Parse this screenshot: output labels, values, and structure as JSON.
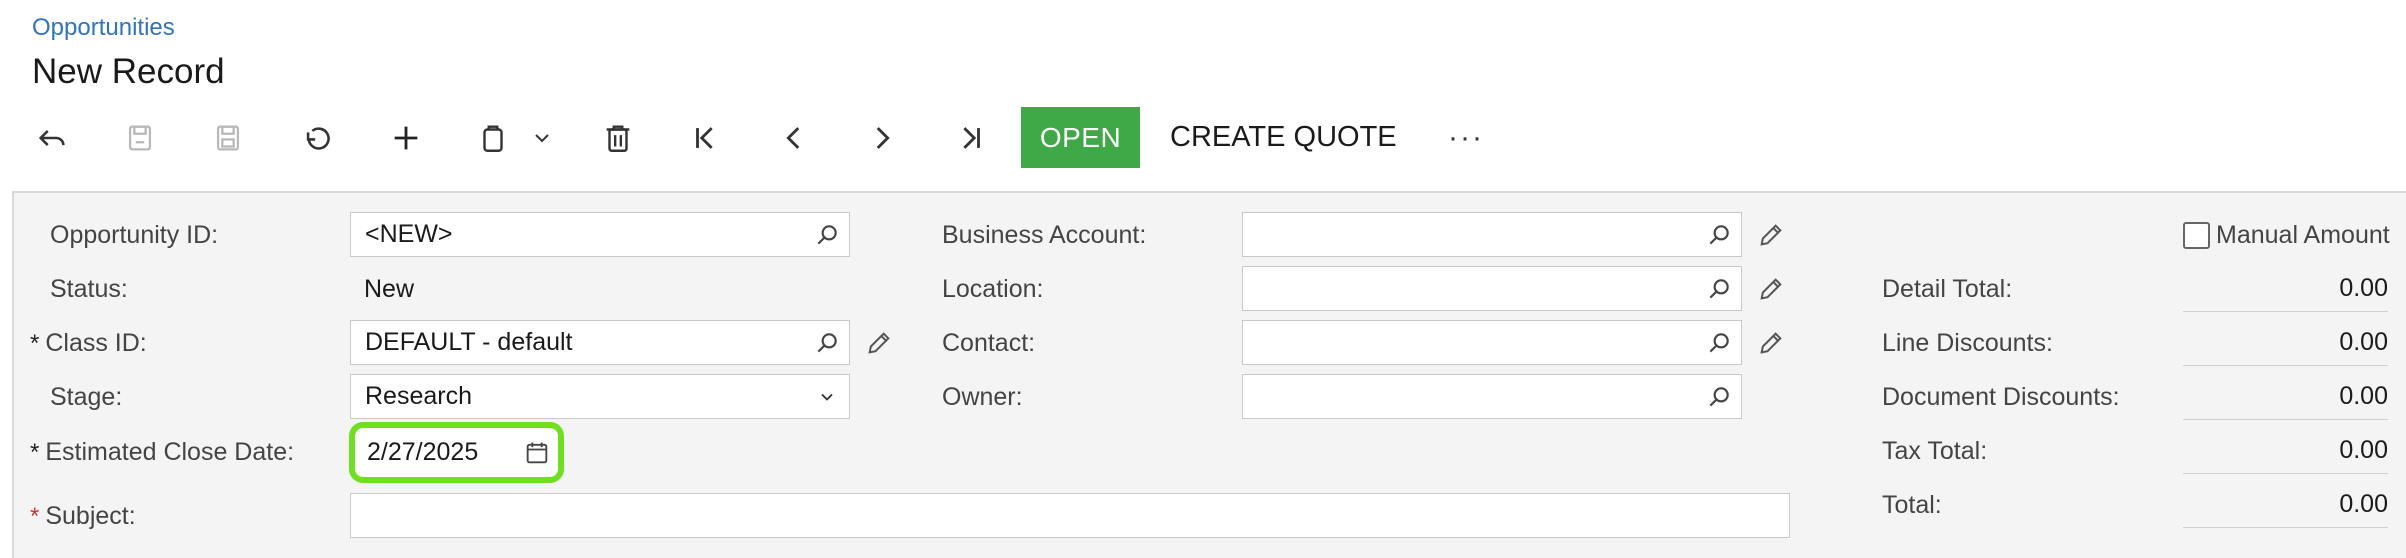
{
  "header": {
    "breadcrumb": "Opportunities",
    "title": "New Record"
  },
  "toolbar": {
    "icons": [
      "undo-back-icon",
      "save-close-icon",
      "save-icon",
      "revert-icon",
      "add-icon",
      "copy-paste-icon",
      "chevron-down-icon",
      "delete-icon",
      "first-record-icon",
      "previous-record-icon",
      "next-record-icon",
      "last-record-icon"
    ],
    "open_label": "OPEN",
    "create_quote_label": "CREATE QUOTE",
    "more_label": "···",
    "colors": {
      "open_bg": "#3fa847"
    }
  },
  "form": {
    "opportunity_id": {
      "label": "Opportunity ID:",
      "value": "<NEW>"
    },
    "status": {
      "label": "Status:",
      "value": "New"
    },
    "class_id": {
      "label": "Class ID:",
      "value": "DEFAULT - default",
      "required": "*"
    },
    "stage": {
      "label": "Stage:",
      "value": "Research"
    },
    "est_close_date": {
      "label": "Estimated Close Date:",
      "value": "2/27/2025",
      "required": "*"
    },
    "subject": {
      "label": "Subject:",
      "value": "",
      "required": "*"
    },
    "business_account": {
      "label": "Business Account:",
      "value": ""
    },
    "location": {
      "label": "Location:",
      "value": ""
    },
    "contact": {
      "label": "Contact:",
      "value": ""
    },
    "owner": {
      "label": "Owner:",
      "value": ""
    }
  },
  "summary": {
    "manual_amount_label": "Manual Amount",
    "manual_amount_checked": false,
    "rows": [
      {
        "label": "Detail Total:",
        "value": "0.00"
      },
      {
        "label": "Line Discounts:",
        "value": "0.00"
      },
      {
        "label": "Document Discounts:",
        "value": "0.00"
      },
      {
        "label": "Tax Total:",
        "value": "0.00"
      },
      {
        "label": "Total:",
        "value": "0.00"
      }
    ]
  },
  "highlight_color": "#6ee01e"
}
